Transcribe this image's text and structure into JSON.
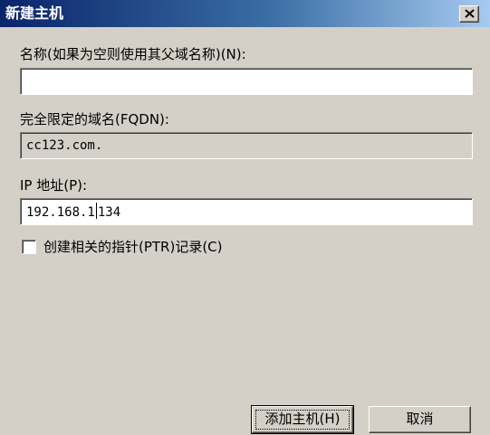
{
  "window": {
    "title": "新建主机",
    "close_icon": "close-icon"
  },
  "name_field": {
    "label": "名称(如果为空则使用其父域名称)(N):",
    "value": ""
  },
  "fqdn_field": {
    "label": "完全限定的域名(FQDN):",
    "value": "cc123.com."
  },
  "ip_field": {
    "label": "IP 地址(P):",
    "value_before_caret": "192.168.1",
    "value_after_caret": "134"
  },
  "ptr_checkbox": {
    "label": "创建相关的指针(PTR)记录(C)",
    "checked": false
  },
  "buttons": {
    "add_host": "添加主机(H)",
    "cancel": "取消"
  }
}
